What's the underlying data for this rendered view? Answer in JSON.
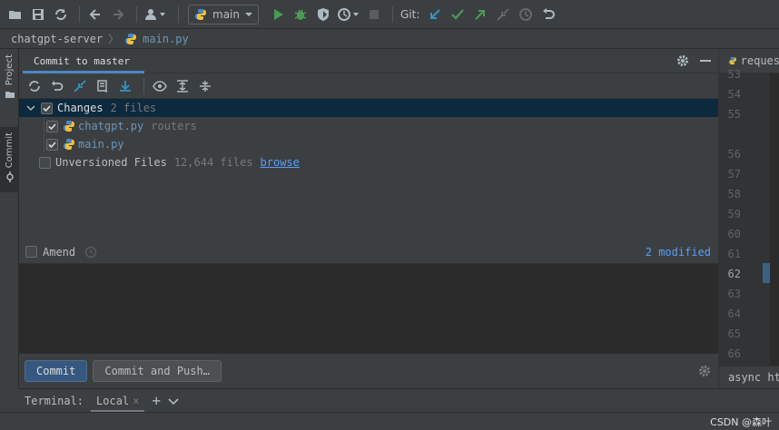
{
  "toolbar": {
    "run_config": "main",
    "git_label": "Git:"
  },
  "breadcrumb": {
    "project": "chatgpt-server",
    "file": "main.py"
  },
  "left_strip": {
    "project_label": "Project",
    "commit_label": "Commit"
  },
  "commit_panel": {
    "tab_label": "Commit to master",
    "changes": {
      "label": "Changes",
      "count": "2 files",
      "files": [
        {
          "name": "chatgpt.py",
          "dir": "routers"
        },
        {
          "name": "main.py",
          "dir": ""
        }
      ]
    },
    "unversioned": {
      "label": "Unversioned Files",
      "count": "12,644 files",
      "link": "browse"
    },
    "amend_label": "Amend",
    "modified_link": "2 modified",
    "commit_button": "Commit",
    "commit_push_button": "Commit and Push…"
  },
  "editor": {
    "tab_label": "reques",
    "line_numbers": [
      "53",
      "54",
      "55",
      "56",
      "57",
      "58",
      "59",
      "60",
      "61",
      "62",
      "63",
      "64",
      "65",
      "66"
    ],
    "current_line": "62",
    "bottom_text": "async ht"
  },
  "terminal": {
    "label": "Terminal:",
    "tab": "Local"
  },
  "watermark": "CSDN @森叶",
  "colors": {
    "background": "#3c3f41",
    "selection": "#0d293e",
    "accent": "#4a88c7",
    "link": "#589df6",
    "run_green": "#499c54",
    "git_blue": "#3592c4"
  }
}
